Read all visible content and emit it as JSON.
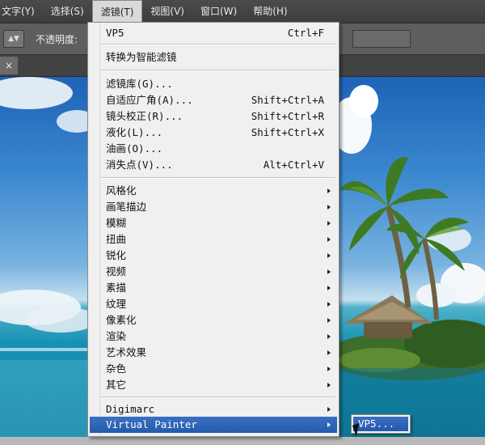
{
  "menubar": {
    "items": [
      {
        "label": "文字(Y)"
      },
      {
        "label": "选择(S)"
      },
      {
        "label": "滤镜(T)"
      },
      {
        "label": "视图(V)"
      },
      {
        "label": "窗口(W)"
      },
      {
        "label": "帮助(H)"
      }
    ]
  },
  "options_bar": {
    "opacity_label": "不透明度:"
  },
  "tab": {
    "close_glyph": "×"
  },
  "filter_menu": {
    "items": [
      {
        "label": "VP5",
        "shortcut": "Ctrl+F"
      },
      {
        "label": "转换为智能滤镜"
      },
      {
        "label": "滤镜库(G)..."
      },
      {
        "label": "自适应广角(A)...",
        "shortcut": "Shift+Ctrl+A"
      },
      {
        "label": "镜头校正(R)...",
        "shortcut": "Shift+Ctrl+R"
      },
      {
        "label": "液化(L)...",
        "shortcut": "Shift+Ctrl+X"
      },
      {
        "label": "油画(O)..."
      },
      {
        "label": "消失点(V)...",
        "shortcut": "Alt+Ctrl+V"
      },
      {
        "label": "风格化"
      },
      {
        "label": "画笔描边"
      },
      {
        "label": "模糊"
      },
      {
        "label": "扭曲"
      },
      {
        "label": "锐化"
      },
      {
        "label": "视频"
      },
      {
        "label": "素描"
      },
      {
        "label": "纹理"
      },
      {
        "label": "像素化"
      },
      {
        "label": "渲染"
      },
      {
        "label": "艺术效果"
      },
      {
        "label": "杂色"
      },
      {
        "label": "其它"
      },
      {
        "label": "Digimarc"
      },
      {
        "label": "Virtual Painter"
      }
    ]
  },
  "submenu": {
    "item": "VP5..."
  },
  "colors": {
    "highlight": "#2c63b6",
    "menu_bg": "#f0f0f0"
  }
}
